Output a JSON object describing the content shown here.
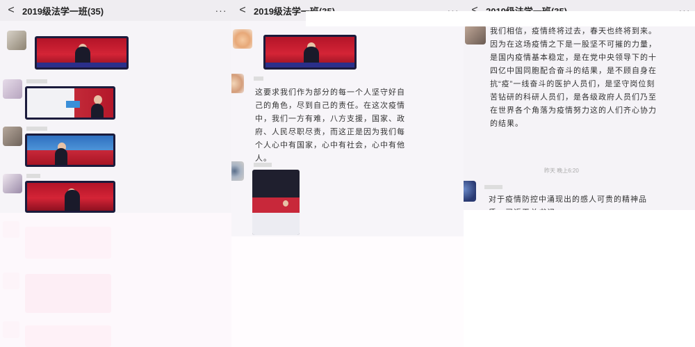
{
  "panel1": {
    "back": "<",
    "title": "2019级法学一班(35)",
    "more": "···"
  },
  "panel2": {
    "back": "<",
    "title": "2019级法学一班(35)",
    "more": "···",
    "message": "这要求我们作为部分的每一个人坚守好自己的角色，尽到自己的责任。在这次疫情中，我们一方有难，八方支援，国家、政府、人民尽职尽责，而这正是因为我们每个人心中有国家，心中有社会，心中有他人。"
  },
  "panel3": {
    "back": "<",
    "title": "2019级法学一班(35)",
    "more": "···",
    "message": "我们相信，疫情终将过去，春天也终将到来。因为在这场疫情之下是一股坚不可摧的力量，是国内疫情基本稳定，是在党中央领导下的十四亿中国同胞配合奋斗的结果，是不顾自身在抗“疫”一线奋斗的医护人员们，是坚守岗位刻苦钻研的科研人员们，是各级政府人员们乃至在世界各个角落为疫情努力这的人们齐心协力的结果。",
    "time": "昨天 晚上6:20",
    "message2": "对于疫情防控中涌现出的感人可贵的精神品质，习近平总书记…"
  },
  "colors": {
    "news_red": "#c3172a",
    "frame_navy": "#1b1b3c",
    "ticker_blue": "#2a2f8a"
  }
}
